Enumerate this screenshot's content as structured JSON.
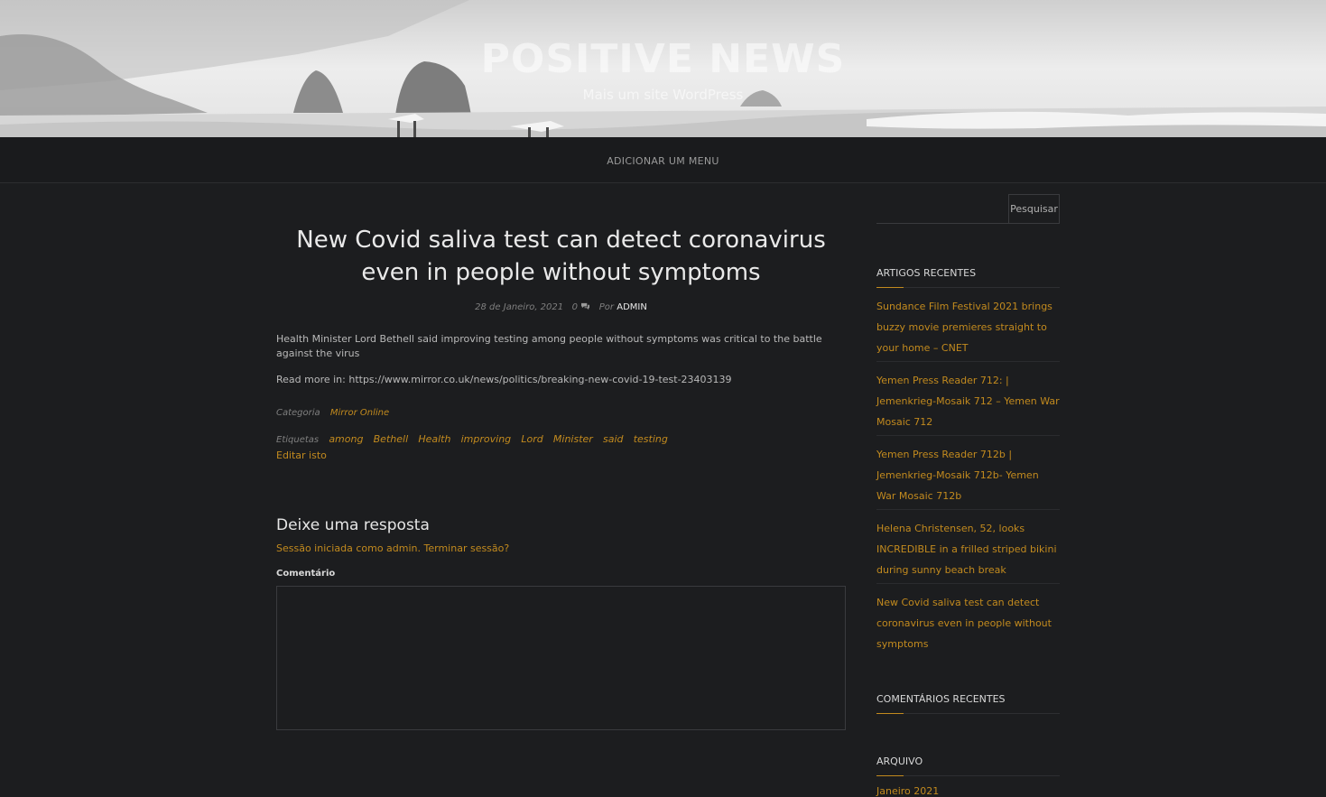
{
  "header": {
    "site_title": "POSITIVE NEWS",
    "site_description": "Mais um site WordPress"
  },
  "menu": {
    "add_menu_label": "ADICIONAR UM MENU"
  },
  "post": {
    "title": "New Covid saliva test can detect coronavirus even in people without symptoms",
    "date": "28 de Janeiro, 2021",
    "comment_count": "0",
    "by_label": "Por",
    "author": "ADMIN",
    "paragraph1": "Health Minister Lord Bethell said improving testing among people without symptoms was critical to the battle against the virus",
    "paragraph2": "Read more in: https://www.mirror.co.uk/news/politics/breaking-new-covid-19-test-23403139",
    "category_label": "Categoria",
    "category": "Mirror Online",
    "tags_label": "Etiquetas",
    "tags": [
      "among",
      "Bethell",
      "Health",
      "improving",
      "Lord",
      "Minister",
      "said",
      "testing"
    ],
    "edit_label": "Editar isto"
  },
  "comments": {
    "reply_title": "Deixe uma resposta",
    "logged_in_text": "Sessão iniciada como admin. Terminar sessão?",
    "comment_label": "Comentário"
  },
  "sidebar": {
    "search_button": "Pesquisar",
    "recent_title": "ARTIGOS RECENTES",
    "recent_posts": [
      "Sundance Film Festival 2021 brings buzzy movie premieres straight to your home – CNET",
      "Yemen Press Reader 712: | Jemenkrieg-Mosaik 712 – Yemen War Mosaic 712",
      "Yemen Press Reader 712b | Jemenkrieg-Mosaik 712b- Yemen War Mosaic 712b",
      "Helena Christensen, 52, looks INCREDIBLE in a frilled striped bikini during sunny beach break",
      "New Covid saliva test can detect coronavirus even in people without symptoms"
    ],
    "comments_title": "COMENTÁRIOS RECENTES",
    "archive_title": "ARQUIVO",
    "archive_item": "Janeiro 2021"
  },
  "colors": {
    "background": "#1c1d1f",
    "accent": "#c28a1e",
    "heading": "#e9e9e9"
  }
}
